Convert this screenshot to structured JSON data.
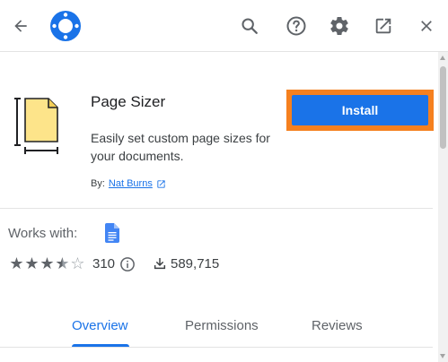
{
  "header": {
    "back_icon": "arrow-left-icon",
    "logo_icon": "workspace-marketplace-logo",
    "actions": [
      "search-icon",
      "help-icon",
      "gear-icon",
      "open-in-new-icon",
      "close-icon"
    ]
  },
  "app": {
    "title": "Page Sizer",
    "description": "Easily set custom page sizes for your documents.",
    "by_label": "By:",
    "author": "Nat Burns",
    "install_label": "Install"
  },
  "compat": {
    "works_with_label": "Works with:",
    "app_icon": "google-docs-icon"
  },
  "stats": {
    "rating": 3.5,
    "rating_max": 5,
    "reviews_count": "310",
    "installs": "589,715"
  },
  "tabs": [
    {
      "label": "Overview",
      "active": true
    },
    {
      "label": "Permissions",
      "active": false
    },
    {
      "label": "Reviews",
      "active": false
    }
  ],
  "colors": {
    "accent": "#1a73e8",
    "highlight_border": "#f5801f",
    "icon_gray": "#5f6368"
  }
}
